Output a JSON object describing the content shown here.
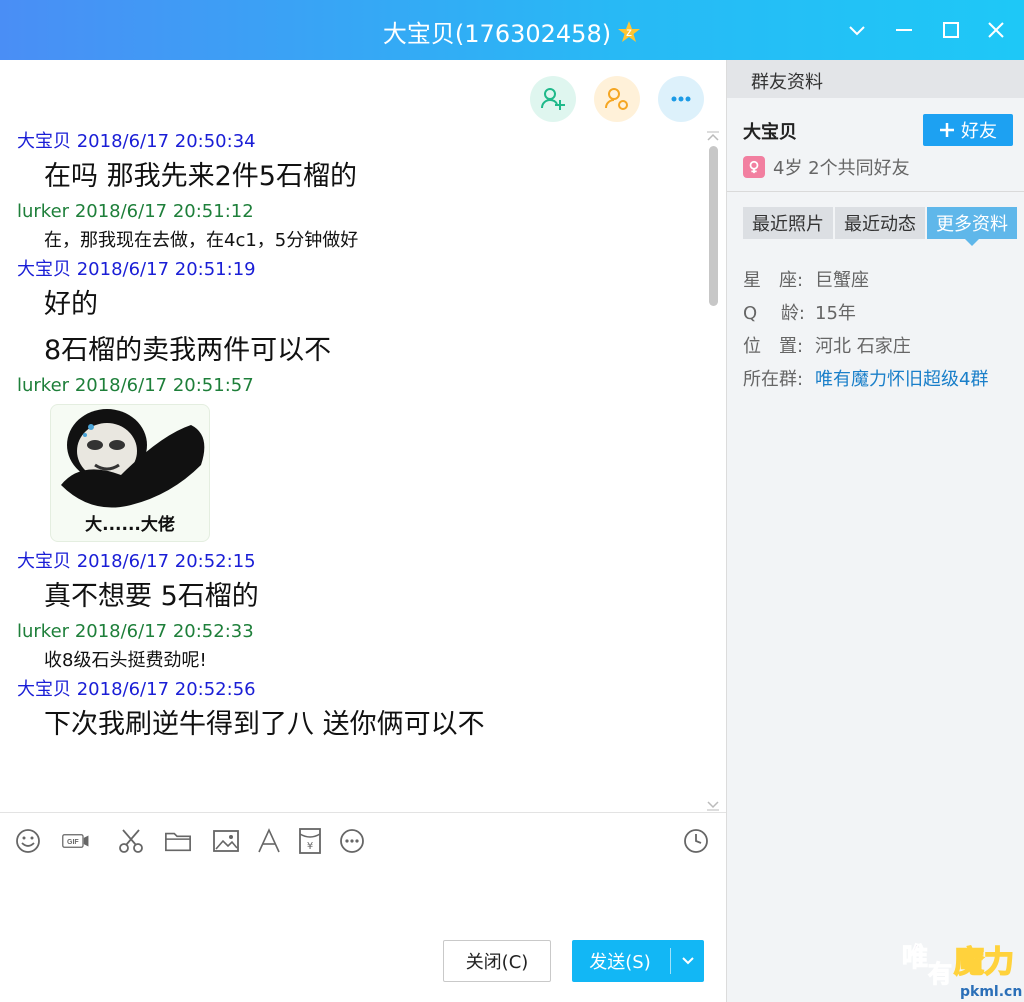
{
  "window": {
    "title": "大宝贝(176302458)",
    "accent": "#28b9f5"
  },
  "chat": {
    "messages": [
      {
        "sender": "大宝贝",
        "time": "2018/6/17 20:50:34",
        "color": "blue",
        "lines": [
          "在吗  那我先来2件5石榴的"
        ],
        "size": "big"
      },
      {
        "sender": "lurker",
        "time": "2018/6/17 20:51:12",
        "color": "green",
        "lines": [
          "在，那我现在去做，在4c1，5分钟做好"
        ],
        "size": "small"
      },
      {
        "sender": "大宝贝",
        "time": "2018/6/17 20:51:19",
        "color": "blue",
        "lines": [
          "好的",
          "8石榴的卖我两件可以不"
        ],
        "size": "big"
      },
      {
        "sender": "lurker",
        "time": "2018/6/17 20:51:57",
        "color": "green",
        "sticker_caption": "大......大佬"
      },
      {
        "sender": "大宝贝",
        "time": "2018/6/17 20:52:15",
        "color": "blue",
        "lines": [
          "真不想要 5石榴的"
        ],
        "size": "big"
      },
      {
        "sender": "lurker",
        "time": "2018/6/17 20:52:33",
        "color": "green",
        "lines": [
          "收8级石头挺费劲呢!"
        ],
        "size": "small"
      },
      {
        "sender": "大宝贝",
        "time": "2018/6/17 20:52:56",
        "color": "blue",
        "lines": [
          "下次我刷逆牛得到了八 送你俩可以不"
        ],
        "size": "big"
      }
    ]
  },
  "toolbar": {
    "tools": [
      "emoji-icon",
      "gif-icon",
      "scissors-icon",
      "folder-icon",
      "image-icon",
      "font-icon",
      "red-packet-icon",
      "more-icon"
    ],
    "history_icon": "clock-icon"
  },
  "buttons": {
    "close_label": "关闭(C)",
    "send_label": "发送(S)"
  },
  "panel": {
    "header": "群友资料",
    "name": "大宝贝",
    "add_friend": "好友",
    "subtitle": "4岁 2个共同好友",
    "tabs": [
      "最近照片",
      "最近动态",
      "更多资料"
    ],
    "active_tab": 2,
    "info": [
      {
        "key": "星　座:",
        "value": "巨蟹座"
      },
      {
        "key": "Q　 龄:",
        "value": "15年"
      },
      {
        "key": "位　置:",
        "value": "河北 石家庄"
      },
      {
        "key": "所在群:",
        "value": "唯有魔力怀旧超级4群",
        "link": true
      }
    ]
  },
  "watermark": {
    "text": "唯有魔力",
    "site": "pkml.cn"
  }
}
